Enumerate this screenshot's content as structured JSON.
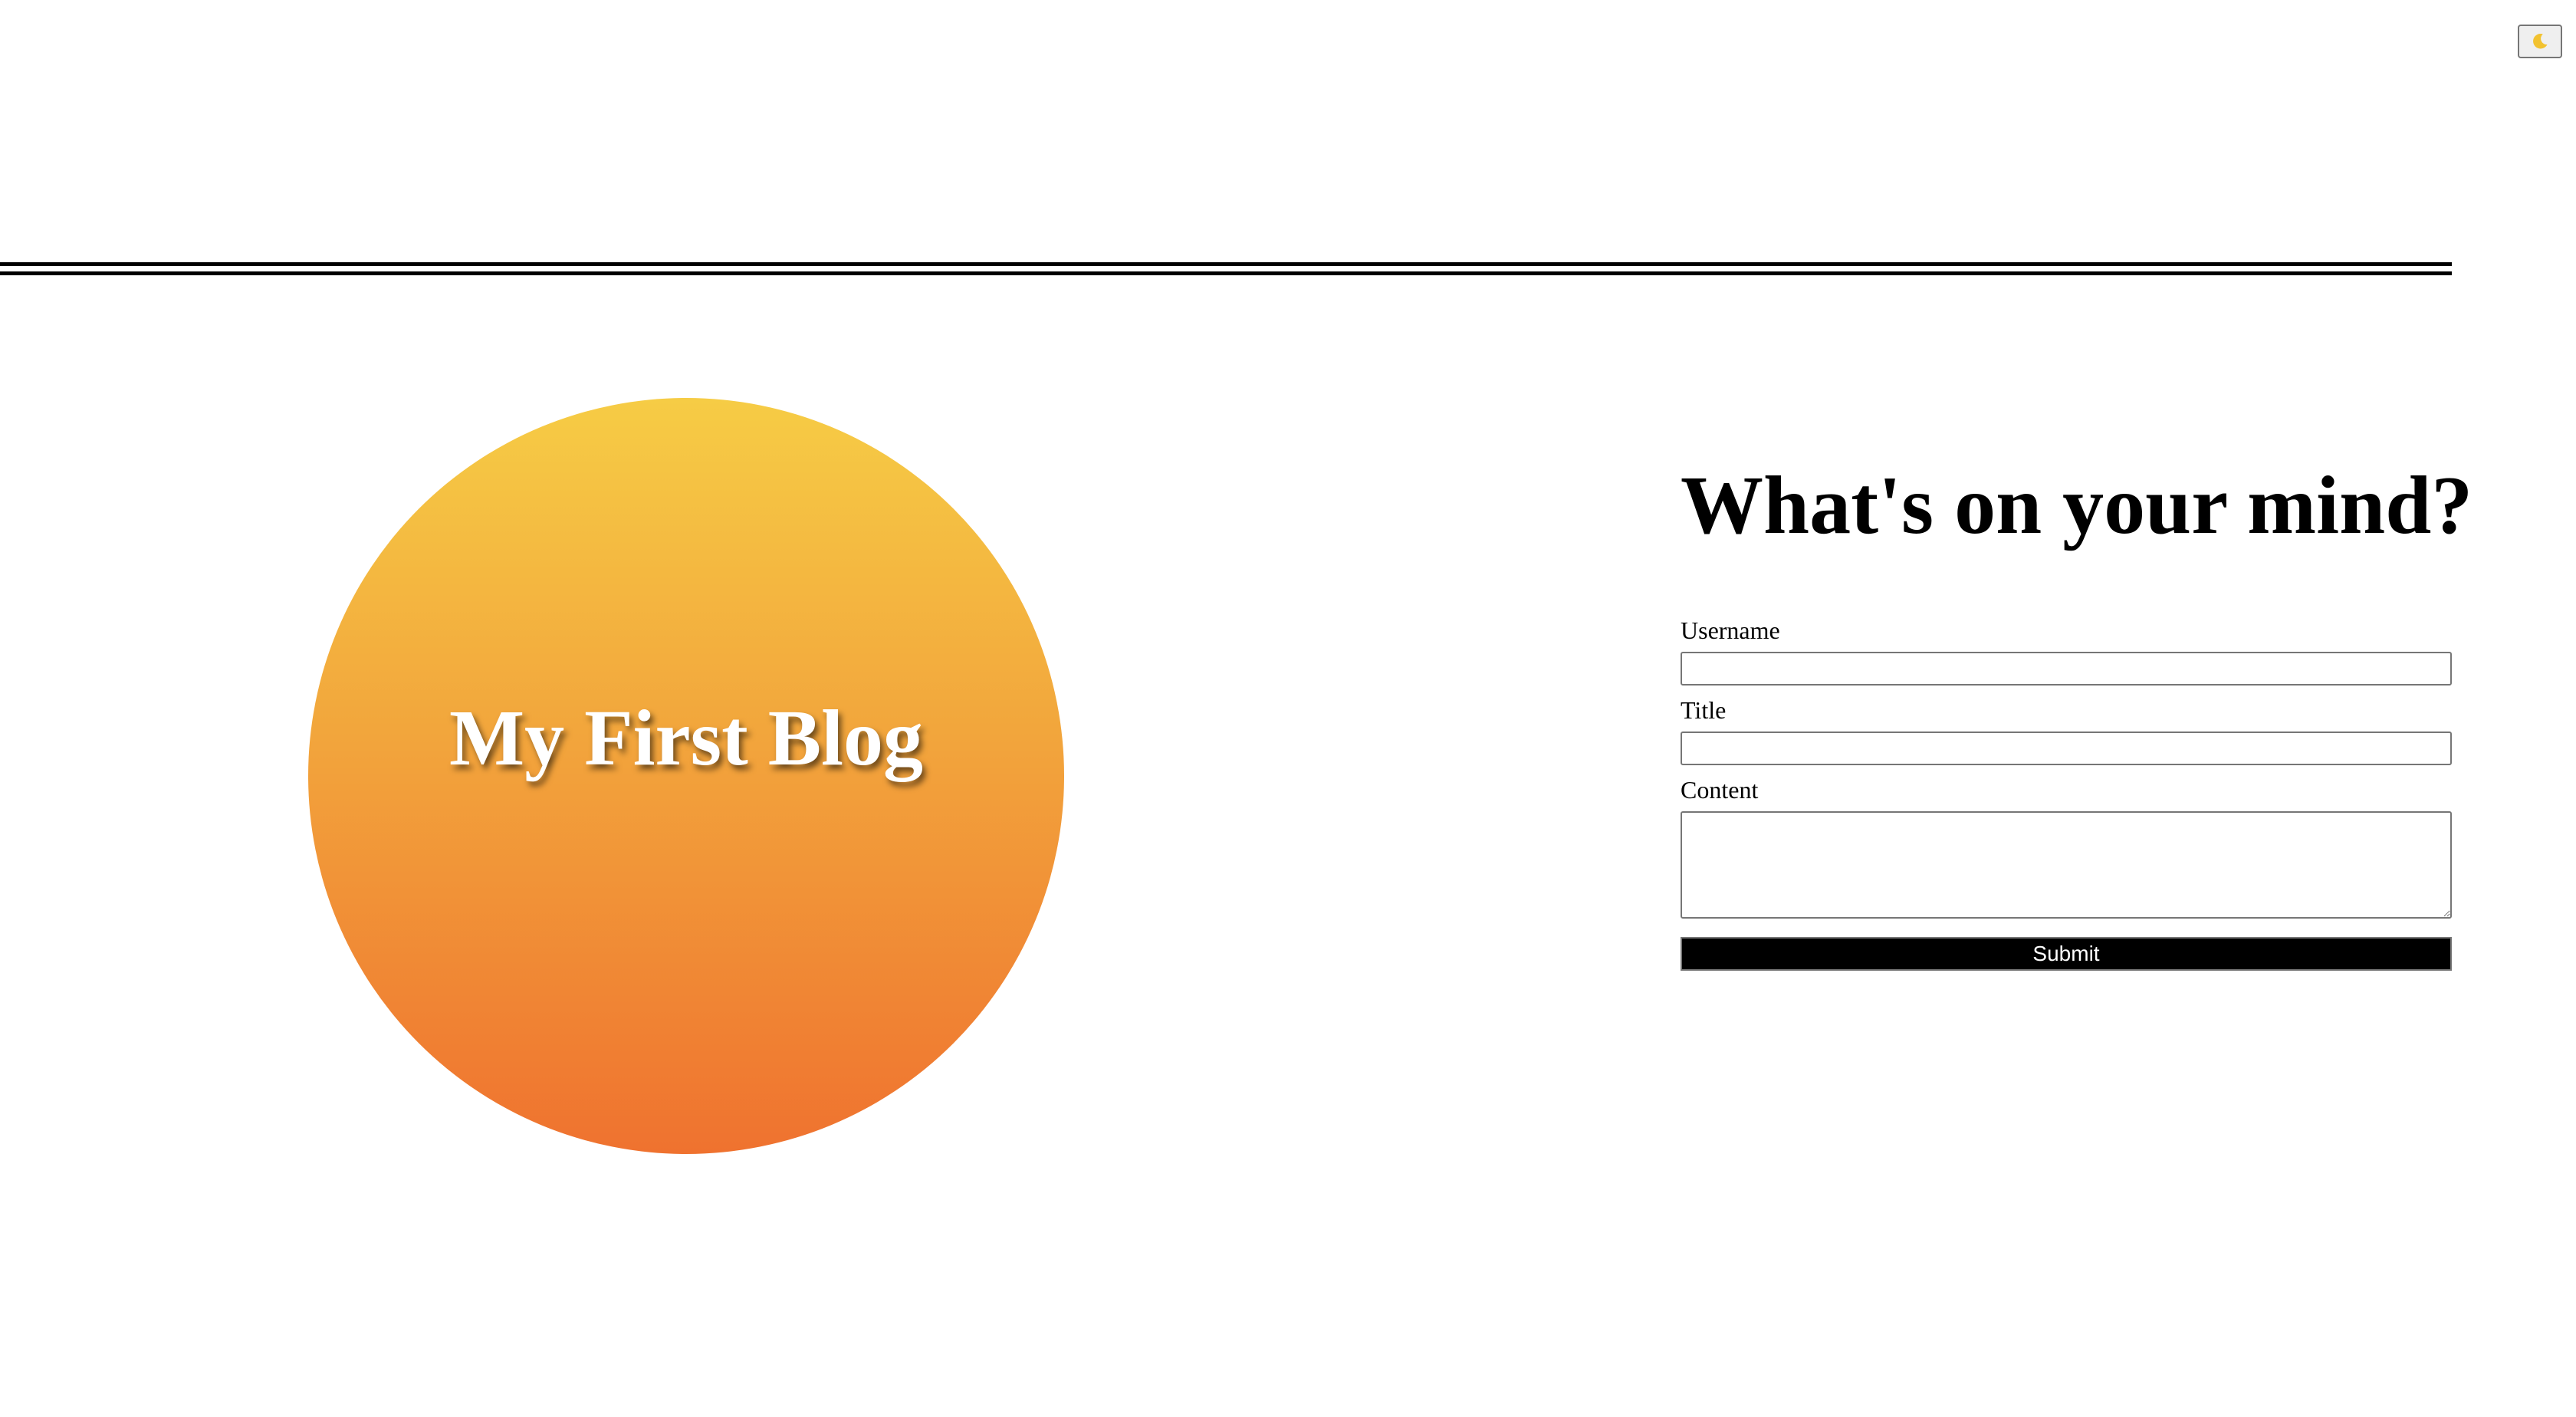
{
  "theme_toggle": {
    "icon": "moon-icon",
    "icon_color": "#f2c230"
  },
  "hero": {
    "title": "My First Blog",
    "gradient_top": "#f6cc45",
    "gradient_bottom": "#ef722f"
  },
  "form": {
    "heading": "What's on your mind?",
    "username_label": "Username",
    "username_value": "",
    "title_label": "Title",
    "title_value": "",
    "content_label": "Content",
    "content_value": "",
    "submit_label": "Submit"
  }
}
